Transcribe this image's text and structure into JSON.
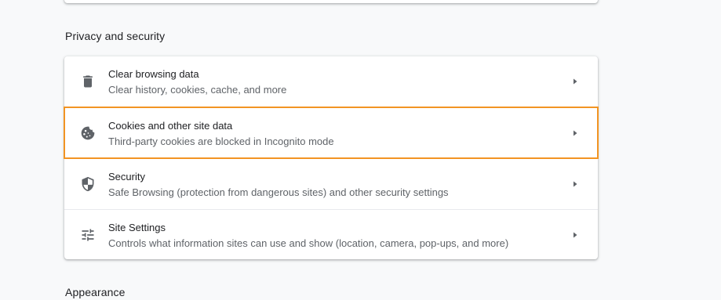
{
  "sections": {
    "privacy_title": "Privacy and security",
    "appearance_title": "Appearance"
  },
  "privacy_items": [
    {
      "icon": "trash-icon",
      "title": "Clear browsing data",
      "subtitle": "Clear history, cookies, cache, and more"
    },
    {
      "icon": "cookie-icon",
      "title": "Cookies and other site data",
      "subtitle": "Third-party cookies are blocked in Incognito mode",
      "highlighted": true
    },
    {
      "icon": "shield-icon",
      "title": "Security",
      "subtitle": "Safe Browsing (protection from dangerous sites) and other security settings"
    },
    {
      "icon": "tune-icon",
      "title": "Site Settings",
      "subtitle": "Controls what information sites can use and show (location, camera, pop-ups, and more)"
    }
  ],
  "colors": {
    "background": "#f8f9fa",
    "card": "#ffffff",
    "highlight_outline": "#f29423",
    "icon": "#5f6368",
    "primary_text": "#202124",
    "secondary_text": "#5f6368"
  }
}
